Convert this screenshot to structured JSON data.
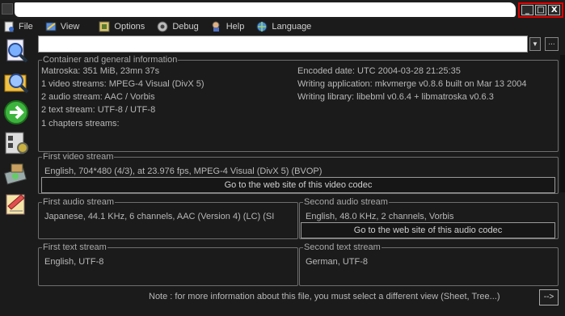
{
  "window": {
    "controls": [
      "_",
      "□",
      "X"
    ]
  },
  "menu": [
    {
      "label": "File",
      "icon": "file-icon"
    },
    {
      "label": "View",
      "icon": "view-icon"
    },
    {
      "label": "Options",
      "icon": "options-icon"
    },
    {
      "label": "Debug",
      "icon": "debug-icon"
    },
    {
      "label": "Help",
      "icon": "help-icon"
    },
    {
      "label": "Language",
      "icon": "language-icon"
    }
  ],
  "file": {
    "value": "",
    "browse_label": "..."
  },
  "sidebar": [
    "open-file-icon",
    "open-folder-icon",
    "go-arrow-icon",
    "settings-icon",
    "export-icon",
    "about-icon"
  ],
  "general": {
    "legend": "Container and general information",
    "left": [
      "Matroska: 351 MiB, 23mn 37s",
      "1 video streams: MPEG-4 Visual (DivX 5)",
      "2 audio stream: AAC / Vorbis",
      "2 text stream: UTF-8 / UTF-8",
      "1 chapters streams:"
    ],
    "right": [
      "Encoded date: UTC 2004-03-28 21:25:35",
      "Writing application: mkvmerge v0.8.6 built on Mar 13 2004",
      "Writing library: libebml v0.6.4 + libmatroska v0.6.3"
    ]
  },
  "video1": {
    "legend": "First video stream",
    "info": "English, 704*480 (4/3), at 23.976 fps, MPEG-4 Visual (DivX 5) (BVOP)",
    "button": "Go to the web site of this video codec"
  },
  "audio1": {
    "legend": "First audio stream",
    "info": "Japanese, 44.1 KHz, 6 channels, AAC (Version 4) (LC) (SI"
  },
  "audio2": {
    "legend": "Second audio stream",
    "info": "English, 48.0 KHz, 2 channels, Vorbis",
    "button": "Go to the web site of this audio codec"
  },
  "text1": {
    "legend": "First text stream",
    "info": "English, UTF-8"
  },
  "text2": {
    "legend": "Second text stream",
    "info": "German, UTF-8"
  },
  "note": "Note : for more information about this file, you must select a different view (Sheet, Tree...)",
  "next_label": "-->"
}
